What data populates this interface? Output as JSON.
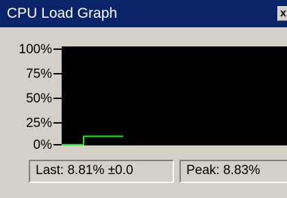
{
  "window": {
    "title": "CPU Load Graph",
    "close_label": "x"
  },
  "graph": {
    "y_axis_labels": [
      "100%",
      "75%",
      "50%",
      "25%",
      "0%"
    ],
    "line_color": "#00ff00",
    "background_color": "#000000",
    "samples_percent": [
      0,
      0,
      0,
      0,
      8.81,
      8.81,
      8.81,
      8.81,
      8.81,
      8.81,
      8.81,
      8.81
    ]
  },
  "status": {
    "last": "Last: 8.81%  ±0.0",
    "peak": "Peak: 8.83%"
  },
  "colors": {
    "titlebar": "#0a246a",
    "face": "#d4d0c8"
  }
}
